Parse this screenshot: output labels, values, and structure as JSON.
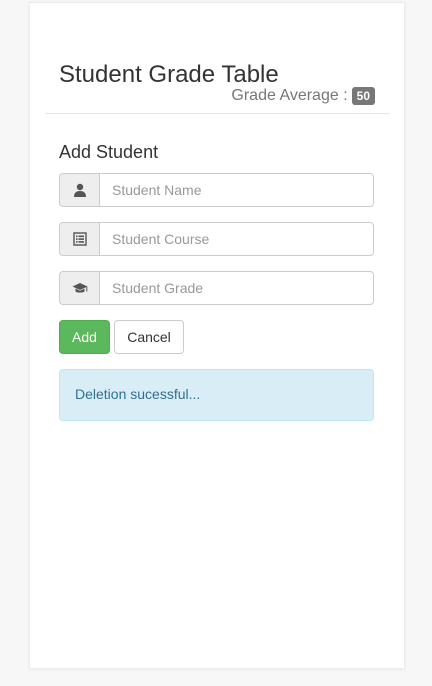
{
  "header": {
    "title": "Student Grade Table",
    "average_label": "Grade Average :",
    "average_value": "50"
  },
  "form": {
    "heading": "Add Student",
    "name_placeholder": "Student Name",
    "course_placeholder": "Student Course",
    "grade_placeholder": "Student Grade",
    "add_label": "Add",
    "cancel_label": "Cancel",
    "icons": [
      "user-icon",
      "list-icon",
      "graduation-cap-icon"
    ]
  },
  "alert": {
    "message": "Deletion sucessful..."
  },
  "colors": {
    "add_button": "#5cb85c",
    "alert_bg": "#d9edf7",
    "alert_text": "#31708f",
    "badge": "#777777"
  }
}
